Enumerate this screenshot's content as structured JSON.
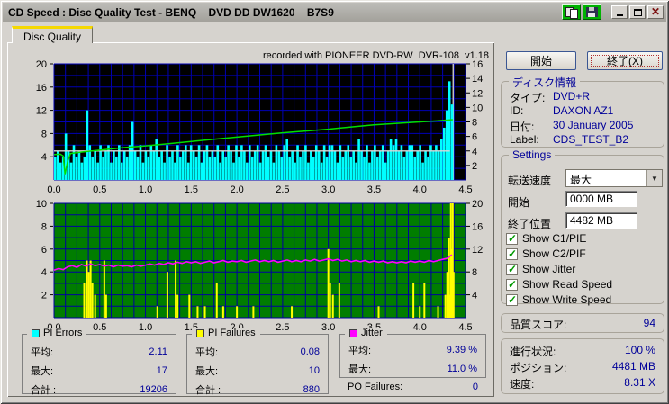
{
  "window": {
    "title": "CD Speed : Disc Quality Test - BENQ    DVD DD DW1620    B7S9"
  },
  "tab": {
    "label": "Disc Quality"
  },
  "recorded_with": "recorded with PIONEER DVD-RW  DVR-108  v1.18",
  "colors": {
    "pi_errors": "#00ffff",
    "pi_failures": "#ffff00",
    "jitter": "#ff00ff",
    "read_speed": "#00e000",
    "write_speed": "#d8d8d8",
    "value_text": "#000099",
    "tab_accent": "#f5d800"
  },
  "chart_data": [
    {
      "type": "bar",
      "name": "pi_errors_chart",
      "bg": "#000000",
      "grid_color": "#0000b4",
      "x_range": [
        0,
        4.5
      ],
      "x_grid_step": 0.125,
      "x_ticks": [
        "0.0",
        "0.5",
        "1.0",
        "1.5",
        "2.0",
        "2.5",
        "3.0",
        "3.5",
        "4.0",
        "4.5"
      ],
      "y_left_range": [
        0,
        20
      ],
      "y_left_ticks": [
        4,
        8,
        12,
        16,
        20
      ],
      "y_grid_step": 2,
      "y_right_range": [
        0,
        16
      ],
      "y_right_ticks": [
        2,
        4,
        6,
        8,
        10,
        12,
        14,
        16
      ],
      "series": [
        {
          "name": "end-marker",
          "type": "vline",
          "color": "#c0c0c0",
          "x": 4.365
        },
        {
          "name": "PI Errors",
          "type": "bars",
          "color": "#00ffff",
          "axis": "left",
          "x_end": 4.37,
          "values": [
            4,
            5,
            3,
            4,
            8,
            5,
            3,
            6,
            4,
            5,
            3,
            4,
            12,
            6,
            4,
            5,
            3,
            6,
            4,
            5,
            6,
            3,
            5,
            4,
            6,
            3,
            5,
            4,
            6,
            10,
            5,
            4,
            6,
            3,
            5,
            4,
            6,
            5,
            7,
            4,
            5,
            3,
            6,
            4,
            5,
            3,
            6,
            4,
            5,
            6,
            3,
            6,
            5,
            4,
            6,
            3,
            5,
            6,
            4,
            5,
            4,
            6,
            3,
            5,
            4,
            6,
            5,
            3,
            6,
            4,
            6,
            5,
            3,
            6,
            4,
            5,
            6,
            3,
            5,
            6,
            4,
            5,
            3,
            6,
            5,
            4,
            6,
            7,
            4,
            5,
            3,
            6,
            4,
            5,
            6,
            3,
            5,
            4,
            6,
            5,
            3,
            6,
            4,
            6,
            6,
            5,
            3,
            6,
            4,
            5,
            6,
            4,
            5,
            3,
            7,
            5,
            4,
            6,
            3,
            5,
            6,
            4,
            5,
            6,
            3,
            5,
            7,
            6,
            7,
            5,
            6,
            4,
            5,
            6,
            6,
            4,
            5,
            6,
            3,
            5,
            4,
            6,
            5,
            6,
            5,
            7,
            9,
            12,
            17,
            13
          ]
        },
        {
          "name": "Write Speed",
          "type": "line",
          "color": "#d8d8d8",
          "axis": "right",
          "width": 1.3,
          "points": [
            [
              0,
              4
            ],
            [
              4.33,
              4
            ]
          ]
        },
        {
          "name": "Read Speed",
          "type": "line",
          "color": "#00e000",
          "axis": "right",
          "width": 1.5,
          "points": [
            [
              0,
              3.5
            ],
            [
              0.07,
              3.55
            ],
            [
              0.1,
              3.3
            ],
            [
              0.12,
              0.8
            ],
            [
              0.15,
              2.6
            ],
            [
              0.18,
              3.65
            ],
            [
              0.3,
              3.85
            ],
            [
              0.5,
              4.1
            ],
            [
              0.75,
              4.45
            ],
            [
              1.0,
              4.7
            ],
            [
              1.25,
              5.0
            ],
            [
              1.5,
              5.3
            ],
            [
              1.75,
              5.6
            ],
            [
              2.0,
              5.9
            ],
            [
              2.25,
              6.2
            ],
            [
              2.5,
              6.5
            ],
            [
              2.75,
              6.75
            ],
            [
              3.0,
              7.0
            ],
            [
              3.25,
              7.3
            ],
            [
              3.5,
              7.6
            ],
            [
              3.75,
              7.8
            ],
            [
              4.0,
              8.0
            ],
            [
              4.2,
              8.15
            ],
            [
              4.36,
              8.31
            ]
          ]
        }
      ]
    },
    {
      "type": "bar",
      "name": "pi_failures_jitter_chart",
      "bg": "#007d00",
      "grid_color": "#0000a0",
      "x_range": [
        0,
        4.5
      ],
      "x_grid_step": 0.125,
      "x_ticks": [
        "0.0",
        "0.5",
        "1.0",
        "1.5",
        "2.0",
        "2.5",
        "3.0",
        "3.5",
        "4.0",
        "4.5"
      ],
      "y_left_range": [
        0,
        10
      ],
      "y_left_ticks": [
        2,
        4,
        6,
        8,
        10
      ],
      "y_grid_step": 1,
      "y_right_range": [
        0,
        20
      ],
      "y_right_ticks": [
        4,
        8,
        12,
        16,
        20
      ],
      "series": [
        {
          "name": "PI Failures",
          "type": "spikes",
          "color": "#ffff00",
          "axis": "left",
          "points": [
            [
              0.33,
              3
            ],
            [
              0.36,
              5
            ],
            [
              0.38,
              4
            ],
            [
              0.4,
              5
            ],
            [
              0.42,
              3
            ],
            [
              0.45,
              2
            ],
            [
              0.55,
              5
            ],
            [
              0.57,
              2
            ],
            [
              1.13,
              1
            ],
            [
              1.24,
              4
            ],
            [
              1.33,
              5
            ],
            [
              1.35,
              2
            ],
            [
              1.48,
              2
            ],
            [
              1.57,
              1
            ],
            [
              1.65,
              1
            ],
            [
              1.78,
              3
            ],
            [
              1.85,
              1
            ],
            [
              2.0,
              1
            ],
            [
              2.18,
              1
            ],
            [
              2.6,
              1
            ],
            [
              3.0,
              6
            ],
            [
              3.02,
              3
            ],
            [
              3.05,
              2
            ],
            [
              3.12,
              3
            ],
            [
              3.55,
              1
            ],
            [
              3.93,
              3
            ],
            [
              4.0,
              1
            ],
            [
              4.05,
              3
            ],
            [
              4.2,
              1
            ],
            [
              4.28,
              2
            ],
            [
              4.3,
              4
            ],
            [
              4.31,
              3
            ],
            [
              4.32,
              7
            ],
            [
              4.33,
              2
            ],
            [
              4.34,
              10
            ],
            [
              4.345,
              5
            ],
            [
              4.35,
              6
            ],
            [
              4.36,
              10
            ],
            [
              4.37,
              4
            ]
          ]
        },
        {
          "name": "Jitter",
          "type": "line",
          "color": "#ff00ff",
          "axis": "left",
          "width": 1.6,
          "x_start": 0,
          "x_step": 0.05,
          "values": [
            4.15,
            4.3,
            4.2,
            4.45,
            4.55,
            4.4,
            4.65,
            4.5,
            4.7,
            4.55,
            4.65,
            4.5,
            4.6,
            4.45,
            4.6,
            4.5,
            4.55,
            4.45,
            4.6,
            4.5,
            4.6,
            4.7,
            4.6,
            4.75,
            4.65,
            4.8,
            4.7,
            4.85,
            4.75,
            4.9,
            4.8,
            4.9,
            4.75,
            4.85,
            4.95,
            4.8,
            4.9,
            5.0,
            4.85,
            4.95,
            4.9,
            5.0,
            4.85,
            4.95,
            5.05,
            4.9,
            5.0,
            4.9,
            5.0,
            4.85,
            4.95,
            5.05,
            4.9,
            5.0,
            4.9,
            5.05,
            4.95,
            5.1,
            4.95,
            5.05,
            5.15,
            5.0,
            5.1,
            4.95,
            5.05,
            4.9,
            5.0,
            4.9,
            5.0,
            4.85,
            4.95,
            4.85,
            4.95,
            4.8,
            4.9,
            4.8,
            4.9,
            4.8,
            4.95,
            4.85,
            4.95,
            4.85,
            5.0,
            4.9,
            5.0,
            5.1,
            5.2,
            5.5
          ]
        }
      ]
    }
  ],
  "legends": [
    {
      "title": "PI Errors",
      "swatch": "#00ffff",
      "rows": [
        {
          "label": "平均:",
          "value": "2.11"
        },
        {
          "label": "最大:",
          "value": "17"
        },
        {
          "label": "合計 :",
          "value": "19206"
        }
      ]
    },
    {
      "title": "PI Failures",
      "swatch": "#ffff00",
      "rows": [
        {
          "label": "平均:",
          "value": "0.08"
        },
        {
          "label": "最大:",
          "value": "10"
        },
        {
          "label": "合計 :",
          "value": "880"
        }
      ]
    },
    {
      "title": "Jitter",
      "swatch": "#ff00ff",
      "rows": [
        {
          "label": "平均:",
          "value": "9.39 %"
        },
        {
          "label": "最大:",
          "value": "11.0 %"
        }
      ]
    }
  ],
  "po_failures": {
    "label": "PO Failures:",
    "value": "0"
  },
  "sidebar": {
    "start_button": "開始",
    "exit_button": "終了(X)",
    "disc_info": {
      "caption": "ディスク情報",
      "rows": [
        {
          "label": "タイプ:",
          "value": "DVD+R"
        },
        {
          "label": "ID:",
          "value": "DAXON AZ1"
        },
        {
          "label": "日付:",
          "value": "30 January 2005"
        },
        {
          "label": "Label:",
          "value": "CDS_TEST_B2"
        }
      ]
    },
    "settings": {
      "caption": "Settings",
      "speed_label": "転送速度",
      "speed_value": "最大",
      "start_label": "開始",
      "start_value": "0000 MB",
      "end_label": "終了位置",
      "end_value": "4482 MB",
      "checkboxes": [
        {
          "label": "Show C1/PIE",
          "checked": true
        },
        {
          "label": "Show C2/PIF",
          "checked": true
        },
        {
          "label": "Show Jitter",
          "checked": true
        },
        {
          "label": "Show Read Speed",
          "checked": true
        },
        {
          "label": "Show Write Speed",
          "checked": true
        }
      ]
    },
    "quality": {
      "label": "品質スコア:",
      "value": "94"
    },
    "progress": {
      "rows": [
        {
          "label": "進行状況:",
          "value": "100 %"
        },
        {
          "label": "ポジション:",
          "value": "4481 MB"
        },
        {
          "label": "速度:",
          "value": "8.31 X"
        }
      ]
    }
  }
}
